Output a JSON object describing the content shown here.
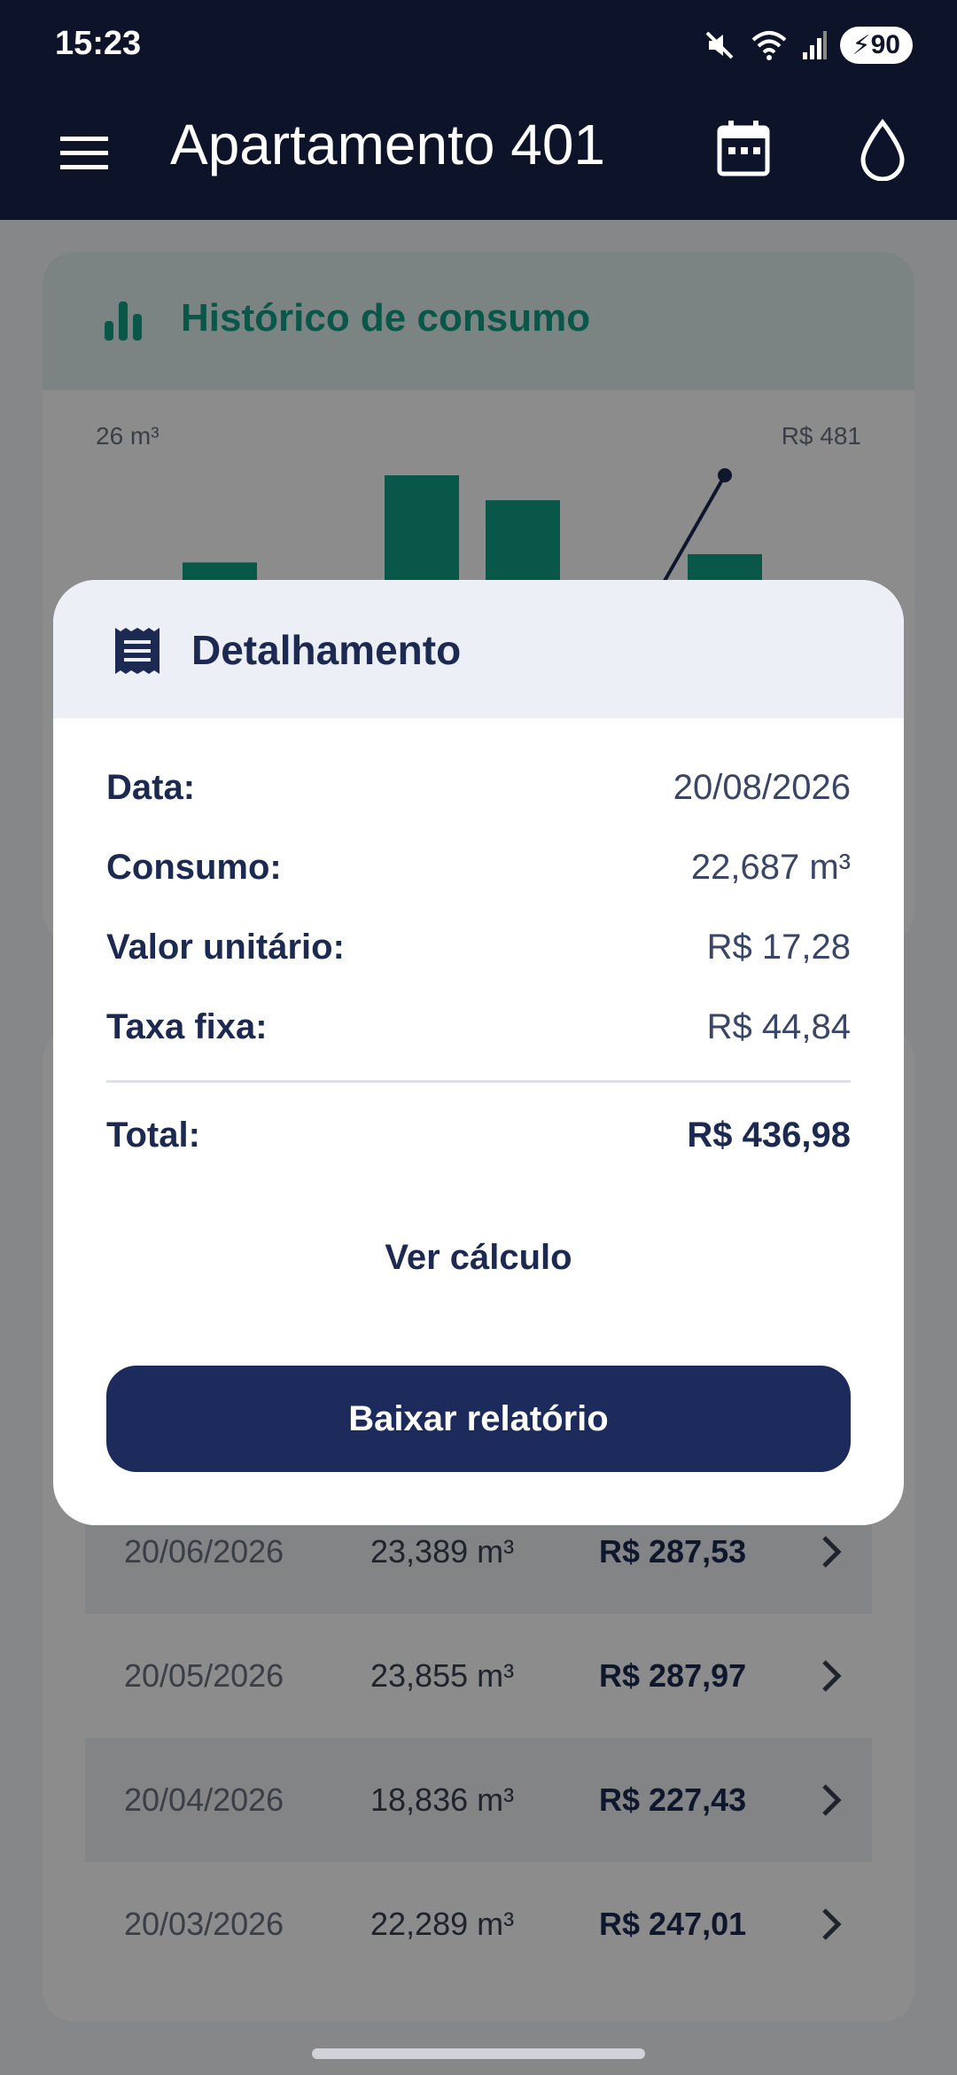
{
  "status_bar": {
    "time": "15:23",
    "battery": "90"
  },
  "app_bar": {
    "title": "Apartamento 401",
    "icons": [
      "menu-icon",
      "calendar-icon",
      "water-drop-icon"
    ]
  },
  "history_card": {
    "title": "Histórico de consumo",
    "left_axis_label": "26 m³",
    "right_axis_label": "R$ 481"
  },
  "chart_data": {
    "type": "bar",
    "bar_relative_heights": [
      0.79,
      0.39,
      1.0,
      0.94,
      0.35,
      0.81
    ],
    "line_last_point_relative": 1.0
  },
  "history_list": [
    {
      "date": "20/06/2026",
      "volume": "23,389 m³",
      "value": "R$ 287,53"
    },
    {
      "date": "20/05/2026",
      "volume": "23,855 m³",
      "value": "R$ 287,97"
    },
    {
      "date": "20/04/2026",
      "volume": "18,836 m³",
      "value": "R$ 227,43"
    },
    {
      "date": "20/03/2026",
      "volume": "22,289 m³",
      "value": "R$ 247,01"
    }
  ],
  "dialog": {
    "title": "Detalhamento",
    "rows": [
      {
        "label": "Data:",
        "value": "20/08/2026"
      },
      {
        "label": "Consumo:",
        "value": "22,687 m³"
      },
      {
        "label": "Valor unitário:",
        "value": "R$ 17,28"
      },
      {
        "label": "Taxa fixa:",
        "value": "R$ 44,84"
      }
    ],
    "total_label": "Total:",
    "total_value": "R$ 436,98",
    "link_label": "Ver cálculo",
    "button_label": "Baixar relatório"
  },
  "colors": {
    "brand_dark": "#0d1429",
    "accent_teal": "#109e84",
    "primary_button": "#1c2a5c"
  }
}
